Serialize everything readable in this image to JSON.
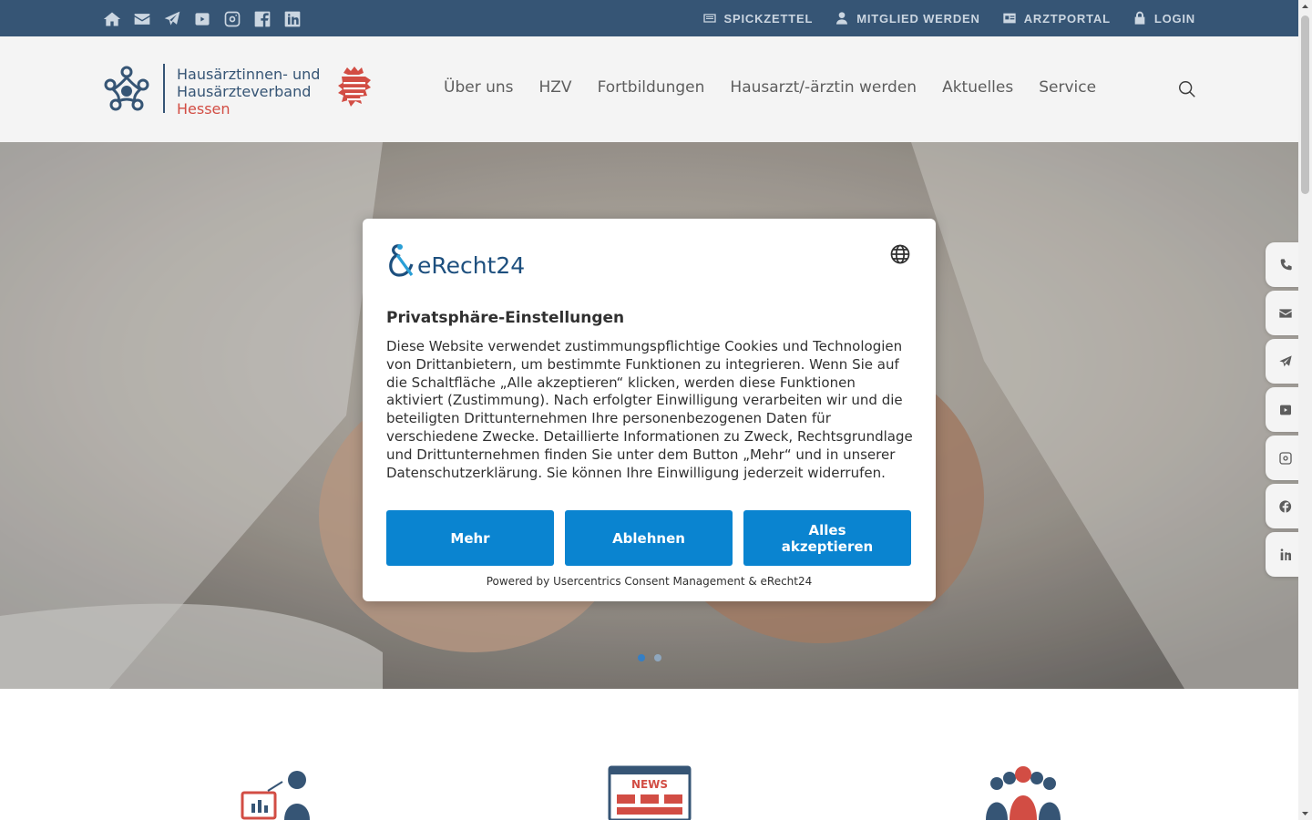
{
  "topbar": {
    "social_icons": [
      "home-icon",
      "mail-icon",
      "telegram-icon",
      "youtube-icon",
      "instagram-icon",
      "facebook-icon",
      "linkedin-icon"
    ],
    "links": [
      {
        "label": "SPICKZETTEL",
        "icon": "note-icon"
      },
      {
        "label": "MITGLIED WERDEN",
        "icon": "user-icon"
      },
      {
        "label": "ARZTPORTAL",
        "icon": "id-card-icon"
      },
      {
        "label": "LOGIN",
        "icon": "lock-icon"
      }
    ]
  },
  "header": {
    "logo": {
      "line1": "Hausärztinnen- und",
      "line2": "Hausärzteverband",
      "line3": "Hessen"
    },
    "nav": [
      "Über uns",
      "HZV",
      "Fortbildungen",
      "Hausarzt/-ärztin werden",
      "Aktuelles",
      "Service"
    ],
    "search_icon": "search-icon"
  },
  "hero": {
    "slides": 2,
    "active_slide": 1
  },
  "sidebar_buttons": [
    "phone-icon",
    "mail-icon",
    "telegram-icon",
    "youtube-icon",
    "instagram-icon",
    "facebook-icon",
    "linkedin-icon"
  ],
  "consent": {
    "brand": "eRecht24",
    "title": "Privatsphäre-Einstellungen",
    "text": "Diese Website verwendet zustimmungspflichtige Cookies und Technologien von Drittanbietern, um bestimmte Funktionen zu integrieren. Wenn Sie auf die Schaltfläche „Alle akzeptieren“ klicken, werden diese Funktionen aktiviert (Zustimmung). Nach erfolgter Einwilligung verarbeiten wir und die beteiligten Drittunternehmen Ihre personenbezogenen Daten für verschiedene Zwecke. Detaillierte Informationen zu Zweck, Rechtsgrundlage und Drittunternehmen finden Sie unter dem Button „Mehr“ und in unserer Datenschutzerklärung. Sie können Ihre Einwilligung jederzeit widerrufen.",
    "buttons": {
      "more": "Mehr",
      "decline": "Ablehnen",
      "accept_all": "Alles akzeptieren"
    },
    "powered_by": "Powered by Usercentrics Consent Management & eRecht24",
    "language_icon": "globe-icon"
  },
  "features": {
    "icons": [
      "presentation-icon",
      "news-icon",
      "team-icon"
    ],
    "news_badge": "NEWS"
  },
  "colors": {
    "topbar_bg": "#2c4c6e",
    "header_bg": "#f4f4f4",
    "button_blue": "#0a84d0",
    "logo_red": "#d0443a",
    "logo_navy": "#2c4c6e"
  }
}
